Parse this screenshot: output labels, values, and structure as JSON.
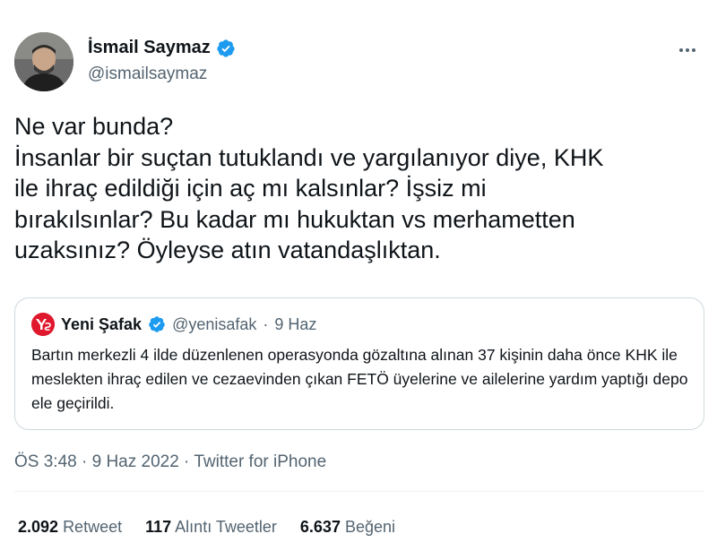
{
  "author": {
    "name": "İsmail Saymaz",
    "handle": "@ismailsaymaz",
    "verified": true
  },
  "tweet": {
    "text": "Ne var bunda?\nİnsanlar bir suçtan tutuklandı ve yargılanıyor diye, KHK\nile ihraç edildiği için aç mı kalsınlar? İşsiz mi\nbırakılsınlar? Bu kadar mı hukuktan vs merhametten\nuzaksınız? Öyleyse atın vatandaşlıktan."
  },
  "quote": {
    "name": "Yeni Şafak",
    "handle": "@yenisafak",
    "separator": "·",
    "date": "9 Haz",
    "avatar_text": "YŞ",
    "text": "Bartın merkezli 4 ilde düzenlenen operasyonda gözaltına alınan 37 kişinin daha önce KHK ile meslekten ihraç edilen ve cezaevinden çıkan FETÖ üyelerine ve ailelerine yardım yaptığı depo ele geçirildi."
  },
  "meta": {
    "timestamp": "ÖS 3:48 · 9 Haz 2022 · Twitter for iPhone"
  },
  "stats": {
    "retweets": "2.092",
    "retweets_label": "Retweet",
    "quotes": "117",
    "quotes_label": "Alıntı Tweetler",
    "likes": "6.637",
    "likes_label": "Beğeni"
  },
  "colors": {
    "verified_blue": "#1d9bf0",
    "secondary_text": "#536471",
    "border": "#cfd9de",
    "brand_red": "#e0182d"
  },
  "icons": {
    "verified": "verified-badge-icon",
    "more": "more-horizontal-icon"
  }
}
